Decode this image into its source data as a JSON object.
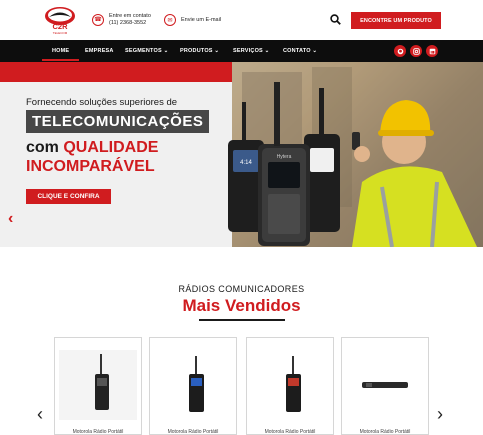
{
  "header": {
    "logo_text": "C2R",
    "logo_sub": "TELECOM",
    "phone_label": "Entre em contato",
    "phone_number": "(11) 2368-3552",
    "email_label": "Envie um E-mail",
    "cta_label": "ENCONTRE UM PRODUTO"
  },
  "nav": {
    "items": [
      {
        "label": "HOME"
      },
      {
        "label": "EMPRESA"
      },
      {
        "label": "SEGMENTOS ⌄"
      },
      {
        "label": "PRODUTOS ⌄"
      },
      {
        "label": "SERVIÇOS ⌄"
      },
      {
        "label": "CONTATO ⌄"
      }
    ],
    "social": [
      "github-icon",
      "instagram-icon",
      "linkedin-icon"
    ]
  },
  "hero": {
    "subtitle": "Fornecendo soluções superiores de",
    "highlight": "TELECOMUNICAÇÕES",
    "line3_prefix": "com ",
    "line3_red": "QUALIDADE",
    "line4": "INCOMPARÁVEL",
    "button_label": "CLIQUE E CONFIRA",
    "radio_brand": "Hytera",
    "radio_time": "4:14"
  },
  "section": {
    "small_title": "RÁDIOS COMUNICADORES",
    "big_title": "Mais Vendidos"
  },
  "products": [
    {
      "name": "Motorola Rádio Portátil"
    },
    {
      "name": "Motorola Rádio Portátil"
    },
    {
      "name": "Motorola Rádio Portátil"
    },
    {
      "name": "Motorola Rádio Portátil"
    }
  ],
  "colors": {
    "accent": "#d01c1f",
    "nav_bg": "#0d0d0d",
    "highlight_bg": "#474747"
  }
}
